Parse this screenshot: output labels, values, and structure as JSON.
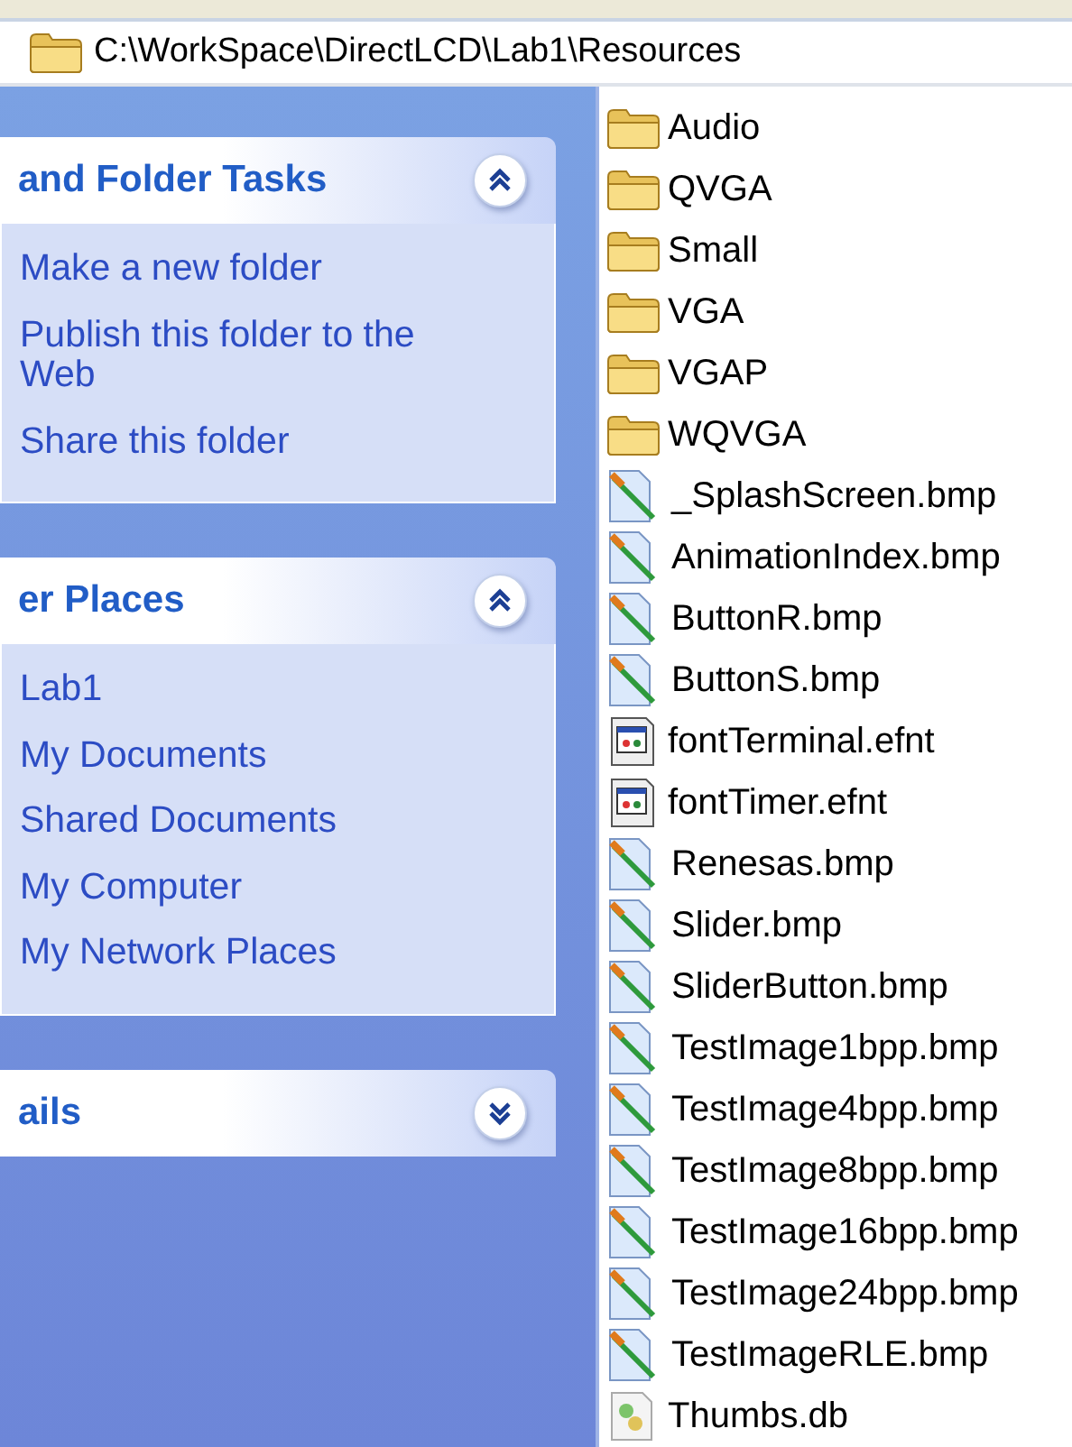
{
  "address_bar": {
    "path": "C:\\WorkSpace\\DirectLCD\\Lab1\\Resources"
  },
  "task_panels": [
    {
      "title": "and Folder Tasks",
      "expanded": true,
      "links": [
        "Make a new folder",
        "Publish this folder to the Web",
        "Share this folder"
      ]
    },
    {
      "title": "er Places",
      "expanded": true,
      "links": [
        "Lab1",
        "My Documents",
        "Shared Documents",
        "My Computer",
        "My Network Places"
      ]
    },
    {
      "title": "ails",
      "expanded": false
    }
  ],
  "files": [
    {
      "name": "Audio",
      "kind": "folder"
    },
    {
      "name": "QVGA",
      "kind": "folder"
    },
    {
      "name": "Small",
      "kind": "folder"
    },
    {
      "name": "VGA",
      "kind": "folder"
    },
    {
      "name": "VGAP",
      "kind": "folder"
    },
    {
      "name": "WQVGA",
      "kind": "folder"
    },
    {
      "name": "_SplashScreen.bmp",
      "kind": "image"
    },
    {
      "name": "AnimationIndex.bmp",
      "kind": "image"
    },
    {
      "name": "ButtonR.bmp",
      "kind": "image"
    },
    {
      "name": "ButtonS.bmp",
      "kind": "image"
    },
    {
      "name": "fontTerminal.efnt",
      "kind": "font"
    },
    {
      "name": "fontTimer.efnt",
      "kind": "font"
    },
    {
      "name": "Renesas.bmp",
      "kind": "image"
    },
    {
      "name": "Slider.bmp",
      "kind": "image"
    },
    {
      "name": "SliderButton.bmp",
      "kind": "image"
    },
    {
      "name": "TestImage1bpp.bmp",
      "kind": "image"
    },
    {
      "name": "TestImage4bpp.bmp",
      "kind": "image"
    },
    {
      "name": "TestImage8bpp.bmp",
      "kind": "image"
    },
    {
      "name": "TestImage16bpp.bmp",
      "kind": "image"
    },
    {
      "name": "TestImage24bpp.bmp",
      "kind": "image"
    },
    {
      "name": "TestImageRLE.bmp",
      "kind": "image"
    },
    {
      "name": "Thumbs.db",
      "kind": "database"
    }
  ]
}
